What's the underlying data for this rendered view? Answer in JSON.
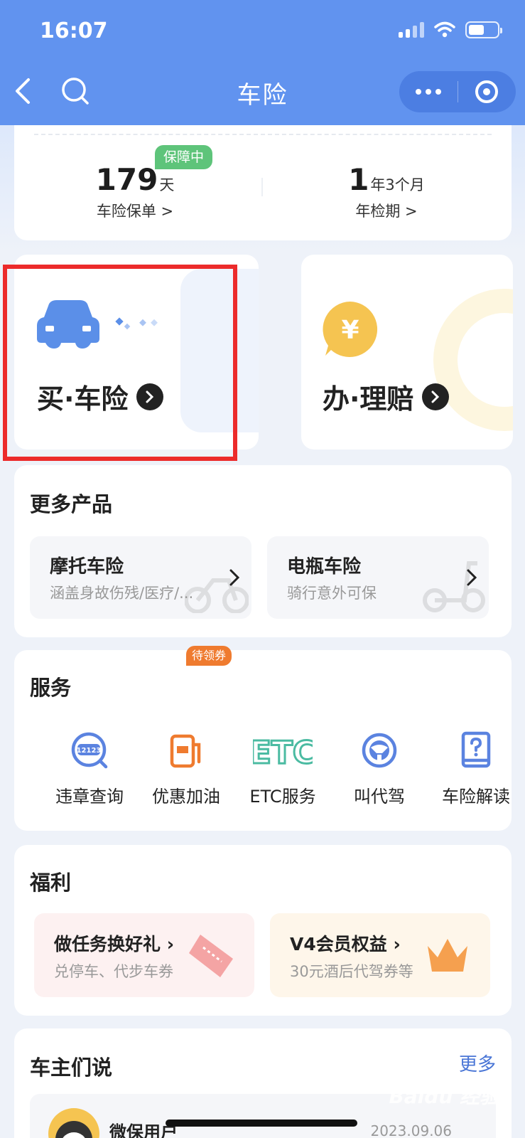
{
  "status_bar": {
    "time": "16:07"
  },
  "nav": {
    "title": "车险"
  },
  "summary": {
    "badge": "保障中",
    "policy_value": "179",
    "policy_unit": "天",
    "policy_label": "车险保单 >",
    "inspection_value": "1",
    "inspection_unit": "年3个月",
    "inspection_label": "年检期 >"
  },
  "actions": {
    "buy_label": "买·车险",
    "claim_label": "办·理赔",
    "claim_icon_symbol": "¥"
  },
  "more_products": {
    "title": "更多产品",
    "items": [
      {
        "name": "摩托车险",
        "desc": "涵盖身故伤残/医疗/..."
      },
      {
        "name": "电瓶车险",
        "desc": "骑行意外可保"
      }
    ]
  },
  "services": {
    "title": "服务",
    "badge": "待领券",
    "items": [
      {
        "label": "违章查询",
        "icon": "violation-query-icon",
        "icon_text": "12123"
      },
      {
        "label": "优惠加油",
        "icon": "fuel-pump-icon"
      },
      {
        "label": "ETC服务",
        "icon": "etc-icon",
        "icon_text": "ETC"
      },
      {
        "label": "叫代驾",
        "icon": "steering-wheel-icon"
      },
      {
        "label": "车险解读",
        "icon": "question-book-icon"
      }
    ]
  },
  "benefits": {
    "title": "福利",
    "items": [
      {
        "name": "做任务换好礼",
        "desc": "兑停车、代步车券"
      },
      {
        "name": "V4会员权益",
        "desc": "30元酒后代驾券等"
      }
    ]
  },
  "reviews": {
    "title": "车主们说",
    "more_label": "更多",
    "first": {
      "user": "微保用户",
      "date": "2023.09.06"
    }
  },
  "watermark": "Baidu 经验",
  "colors": {
    "header": "#6193ef",
    "badge_green": "#5ec47a",
    "highlight_red": "#ec2b2b",
    "link_blue": "#4a76d6",
    "service_blue": "#5b83e0",
    "fuel_orange": "#ef7b2f",
    "etc_teal": "#4bbba2"
  }
}
